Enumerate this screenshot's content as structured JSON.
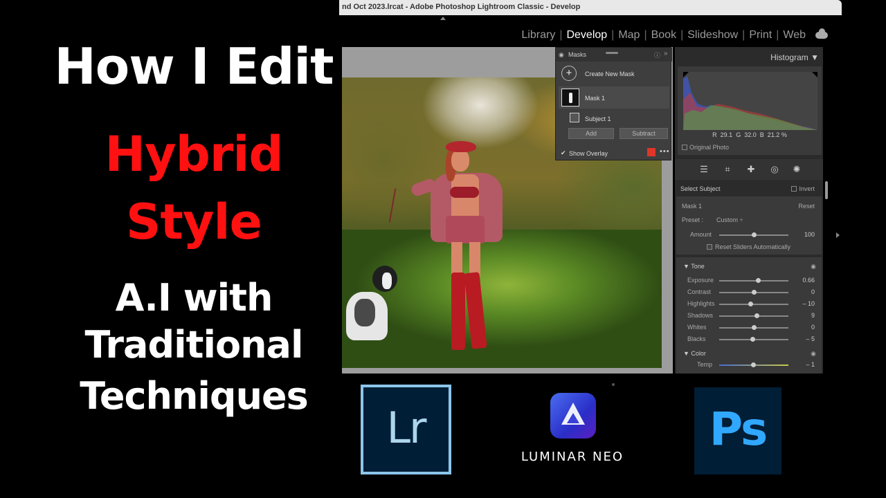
{
  "thumbnail": {
    "line1": "How I Edit",
    "line2": "Hybrid",
    "line3": "Style",
    "line4": "A.I with",
    "line5": "Traditional",
    "line6": "Techniques"
  },
  "window": {
    "title": "nd Oct 2023.lrcat - Adobe Photoshop Lightroom Classic - Develop"
  },
  "modules": [
    {
      "label": "Library"
    },
    {
      "label": "Develop"
    },
    {
      "label": "Map"
    },
    {
      "label": "Book"
    },
    {
      "label": "Slideshow"
    },
    {
      "label": "Print"
    },
    {
      "label": "Web"
    }
  ],
  "masks": {
    "title": "Masks",
    "info_icon": "info-icon",
    "create_label": "Create New Mask",
    "mask1_label": "Mask 1",
    "subject_label": "Subject 1",
    "add_label": "Add",
    "subtract_label": "Subtract",
    "show_overlay_label": "Show Overlay",
    "overlay_color": "#e0352a"
  },
  "histogram": {
    "title": "Histogram",
    "r_label": "R",
    "r_value": "29.1",
    "g_label": "G",
    "g_value": "32.0",
    "b_label": "B",
    "b_value": "21.2",
    "pct": "%",
    "original_photo_label": "Original Photo"
  },
  "mask_settings": {
    "select_subject": "Select Subject",
    "invert": "Invert",
    "mask_label": "Mask 1",
    "reset": "Reset",
    "preset_label": "Preset :",
    "preset_value": "Custom",
    "amount_label": "Amount",
    "amount_value": "100",
    "amount_fraction": 0.5,
    "reset_sliders_label": "Reset Sliders Automatically"
  },
  "tone": {
    "title": "Tone",
    "sliders": [
      {
        "label": "Exposure",
        "value": "0.66",
        "pos": 0.56
      },
      {
        "label": "Contrast",
        "value": "0",
        "pos": 0.5
      },
      {
        "label": "Highlights",
        "value": "– 10",
        "pos": 0.45
      },
      {
        "label": "Shadows",
        "value": "9",
        "pos": 0.54
      },
      {
        "label": "Whites",
        "value": "0",
        "pos": 0.5
      },
      {
        "label": "Blacks",
        "value": "– 5",
        "pos": 0.48
      }
    ]
  },
  "color": {
    "title": "Color",
    "temp_label": "Temp",
    "temp_value": "– 1",
    "temp_pos": 0.49
  },
  "logos": {
    "lr_text": "Lr",
    "luminar_text": "LUMINAR NEO",
    "ps_text": "Ps"
  }
}
